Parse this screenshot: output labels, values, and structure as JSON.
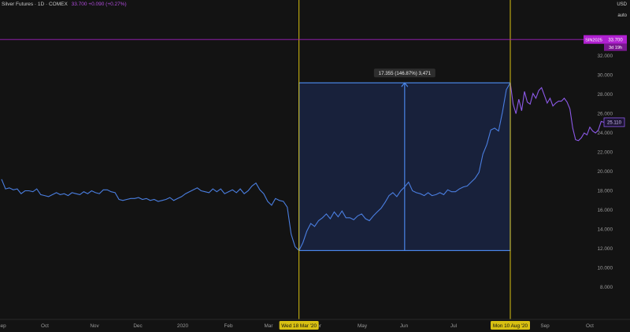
{
  "header": {
    "symbol_text": "Silver Futures · 1D · COMEX",
    "quote_text": "33.700 +0.090 (+0.27%)"
  },
  "topright": {
    "currency": "USD",
    "button": "auto"
  },
  "badges": {
    "sin_label": "SIN2025",
    "sin_price": "33.700",
    "sin_time": "3d 19h",
    "last_price": "25.110"
  },
  "measure": {
    "label": "17.355 (146.87%) 3,471",
    "from_price": 11.8,
    "to_price": 29.2
  },
  "markers": [
    {
      "date_label": "Wed 18 Mar '20"
    },
    {
      "date_label": "Mon 10 Aug '20"
    }
  ],
  "colors": {
    "background": "#131313",
    "line_main": "#4a7ee0",
    "line_recent": "#8c59e8",
    "marker": "#d8c012",
    "badge_bg": "#b020d0",
    "measure_fill": "#1a2543",
    "measure_stroke": "#4a86e8"
  },
  "chart_data": {
    "type": "line",
    "title": "Silver Futures · 1D · COMEX",
    "xlabel": "",
    "ylabel": "",
    "ylim": [
      6.5,
      34.5
    ],
    "yticks": [
      "8.000",
      "10.000",
      "12.000",
      "14.000",
      "16.000",
      "18.000",
      "20.000",
      "22.000",
      "24.000",
      "26.000",
      "28.000",
      "30.000",
      "32.000"
    ],
    "x_ticks": [
      "Sep",
      "Oct",
      "Nov",
      "Dec",
      "2020",
      "Feb",
      "Mar",
      "Apr",
      "May",
      "Jun",
      "Jul",
      "Aug",
      "Sep",
      "Oct"
    ],
    "grid": false,
    "series": [
      {
        "values": [
          19.2,
          18.2,
          18.3,
          18.1,
          18.2,
          17.7,
          18.0,
          18.0,
          17.9,
          18.2,
          17.6,
          17.5,
          17.4,
          17.6,
          17.8,
          17.6,
          17.7,
          17.5,
          17.8,
          17.7,
          17.6,
          17.9,
          17.7,
          18.0,
          17.8,
          17.7,
          18.1,
          18.1,
          17.9,
          17.8,
          17.1,
          17.0,
          17.1,
          17.2,
          17.2,
          17.3,
          17.1,
          17.2,
          17.0,
          17.1,
          16.9,
          17.0,
          17.1,
          17.3,
          17.0,
          17.2,
          17.4,
          17.7,
          17.9,
          18.1,
          18.3,
          18.0,
          17.9,
          17.8,
          18.2,
          17.9,
          18.2,
          17.7,
          17.9,
          18.1,
          17.8,
          18.2,
          17.7,
          18.0,
          18.5,
          18.8,
          18.1,
          17.7,
          16.9,
          16.5,
          17.2,
          17.0,
          16.9,
          16.3,
          13.5,
          12.2,
          11.8,
          12.6,
          13.8,
          14.6,
          14.3,
          14.9,
          15.2,
          15.6,
          15.1,
          15.8,
          15.3,
          15.9,
          15.2,
          15.2,
          15.0,
          15.4,
          15.6,
          15.1,
          14.9,
          15.4,
          15.8,
          16.2,
          16.8,
          17.5,
          17.8,
          17.4,
          18.0,
          18.4,
          18.9,
          18.0,
          17.8,
          17.7,
          17.5,
          17.8,
          17.5,
          17.6,
          17.8,
          17.6,
          18.1,
          17.9,
          17.9,
          18.2,
          18.4,
          18.5,
          18.9,
          19.3,
          19.9,
          21.8,
          22.8,
          24.3,
          24.5,
          24.2,
          26.2,
          28.5,
          29.2
        ],
        "color": "#4a7ee0"
      },
      {
        "values": [
          29.2,
          27.0,
          26.0,
          27.5,
          26.3,
          28.3,
          27.2,
          27.0,
          28.1,
          27.6,
          28.4,
          28.7,
          27.9,
          27.1,
          27.6,
          26.8,
          27.1,
          27.3,
          27.3,
          27.6,
          27.2,
          26.5,
          24.5,
          23.3,
          23.2,
          23.5,
          24.0,
          23.8,
          24.6,
          24.2,
          24.0,
          24.3,
          25.2,
          25.1
        ],
        "color": "#8c59e8"
      }
    ]
  },
  "x_axis": [
    "Sep",
    "Oct",
    "Nov",
    "Dec",
    "2020",
    "Feb",
    "Mar",
    "Apr",
    "May",
    "Jun",
    "Jul",
    "Aug",
    "Sep",
    "Oct"
  ],
  "y_axis": [
    "8.000",
    "10.000",
    "12.000",
    "14.000",
    "16.000",
    "18.000",
    "20.000",
    "22.000",
    "24.000",
    "26.000",
    "28.000",
    "30.000",
    "32.000"
  ]
}
